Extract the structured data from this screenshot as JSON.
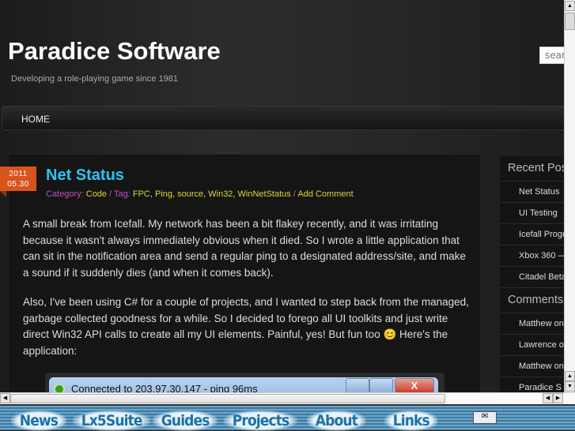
{
  "header": {
    "title": "Paradice Software",
    "tagline": "Developing a role-playing game since 1981",
    "search_placeholder": "search"
  },
  "nav": {
    "home": "HOME"
  },
  "post": {
    "date_year": "2011",
    "date_md": "05.30",
    "title": "Net Status",
    "meta": {
      "category_label": "Category: ",
      "category": "Code",
      "tag_label": " / Tag: ",
      "tags": "FPC, Ping, source, Win32, WinNetStatus",
      "sep": " / ",
      "comment": "Add Comment"
    },
    "p1": "A small break from Icefall. My network has been a bit flakey recently, and it was irritating because it wasn't always immediately obvious when it died. So I wrote a little application that can sit in the notification area and send a regular ping to a designated address/site, and make a sound if it suddenly dies (and when it comes back).",
    "p2": "Also, I've been using C# for a couple of projects, and I wanted to step back from the managed, garbage collected goodness for a while. So I decided to forego all UI toolkits and just write direct Win32 API calls to create all my UI elements. Painful, yes! But fun too 😊  Here's the application:",
    "screenshot_title": "Connected to 203.97.30.147 - ping 96ms",
    "close": "X"
  },
  "sidebar": {
    "recent_heading": "Recent Posts",
    "recent": [
      "Net Status",
      "UI Testing",
      "Icefall Progress",
      "Xbox 360 —",
      "Citadel Beta"
    ],
    "comments_heading": "Comments",
    "comments": [
      "Matthew on",
      "Lawrence on",
      "Matthew on",
      "Paradice S"
    ]
  },
  "bottom_nav": [
    "News",
    "Lx5Suite",
    "Guides",
    "Projects",
    "About",
    "Links"
  ]
}
